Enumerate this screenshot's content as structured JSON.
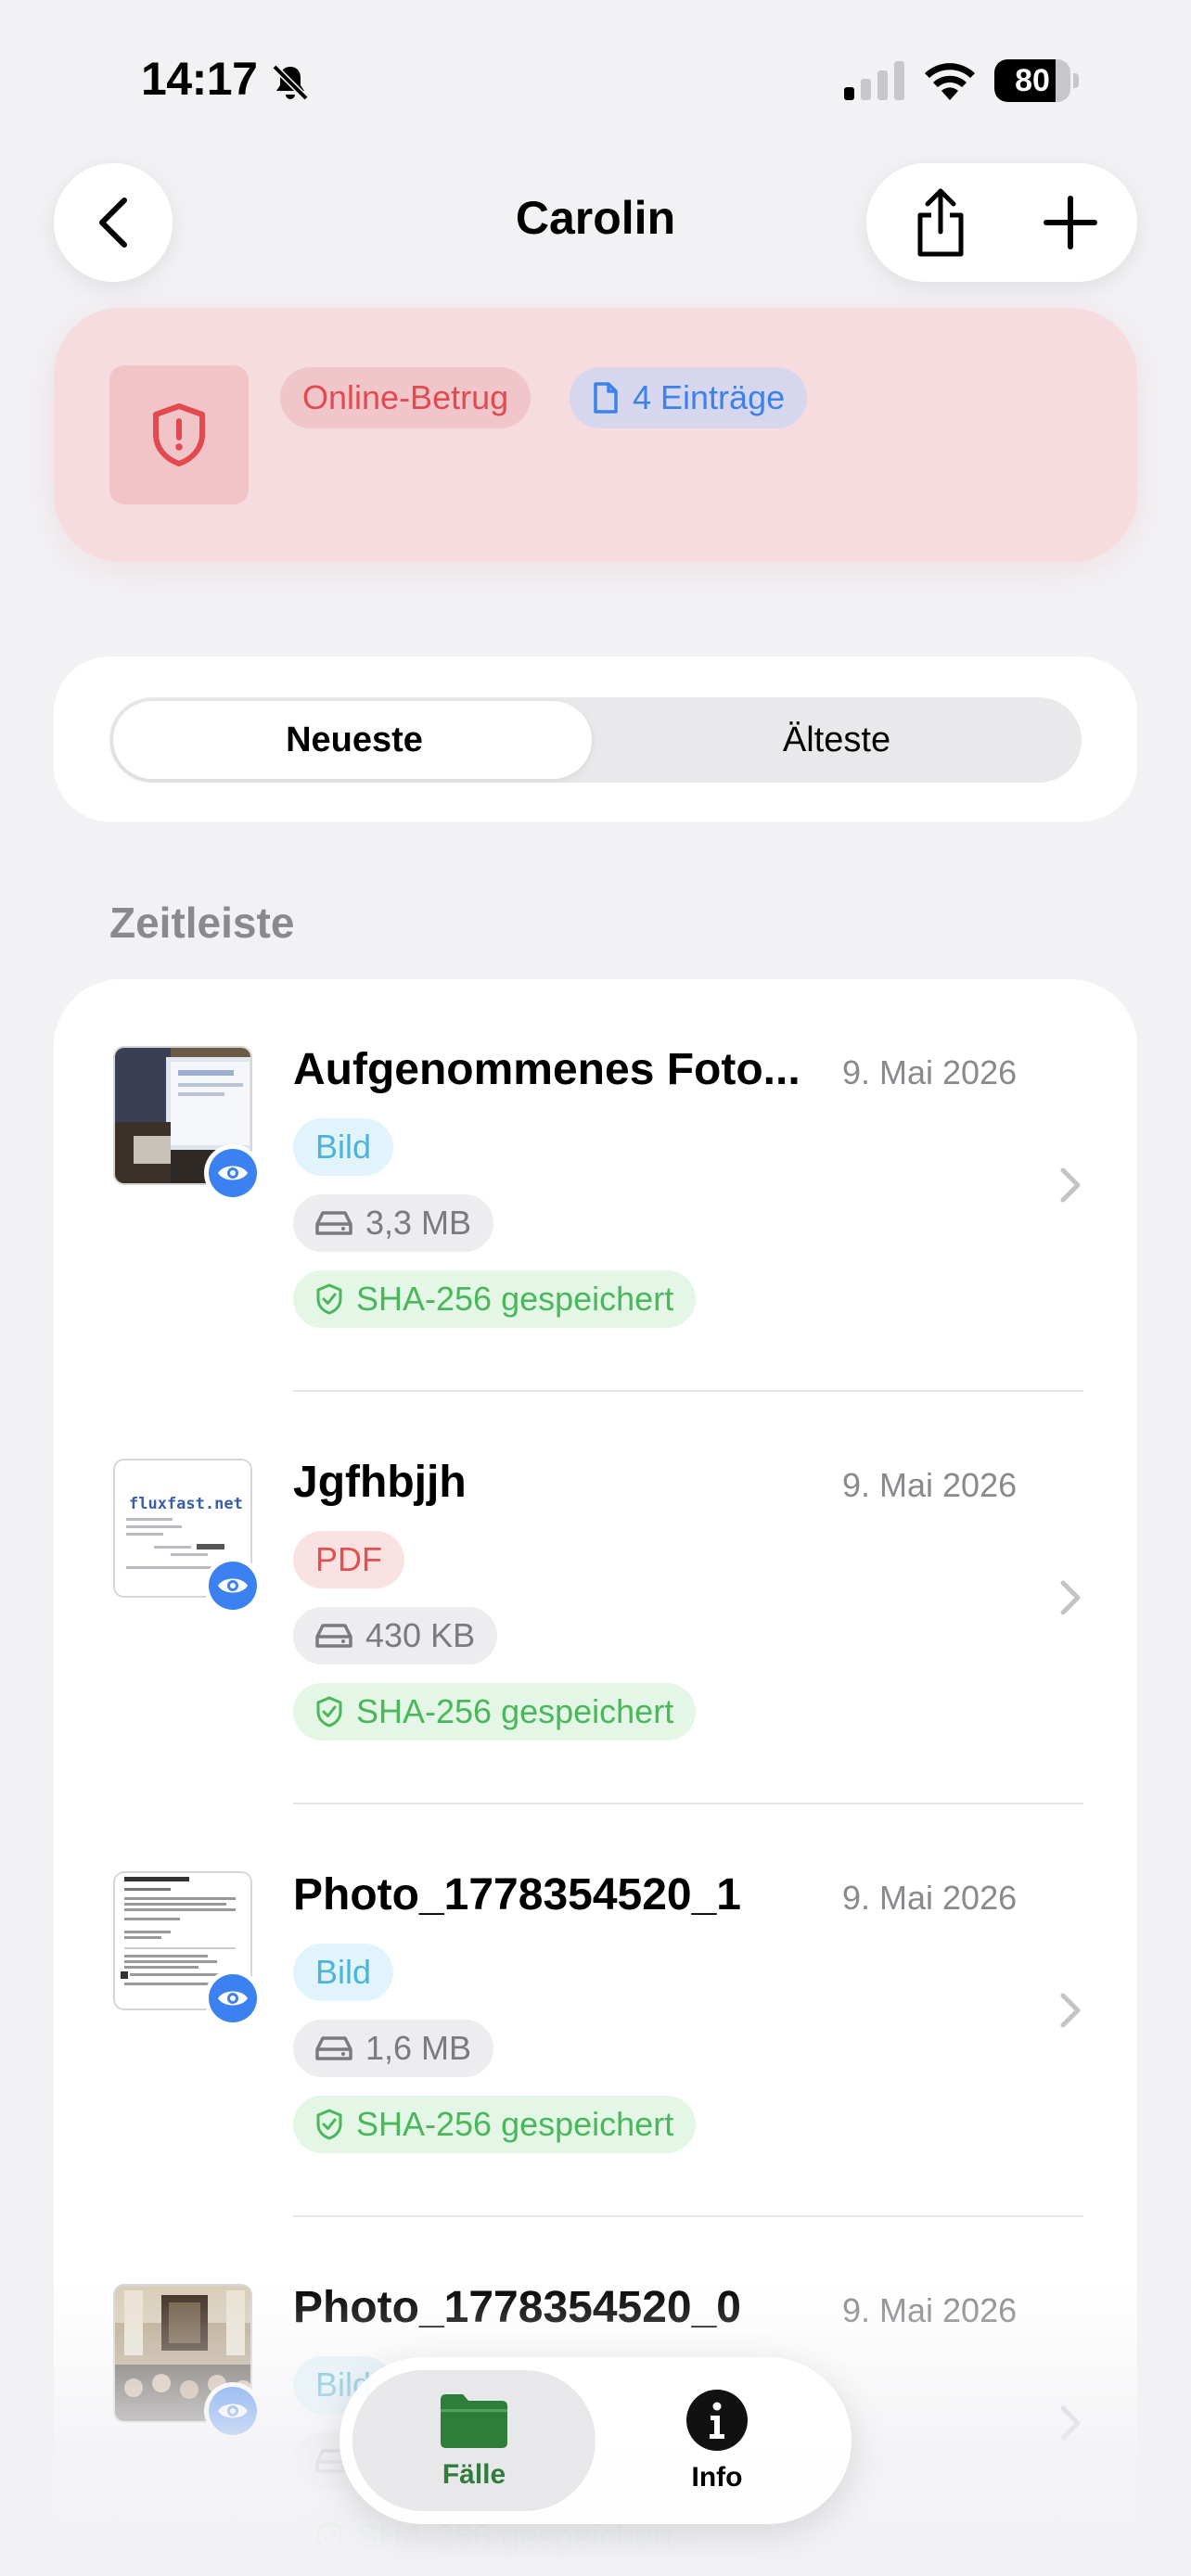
{
  "status": {
    "time": "14:17",
    "battery": "80",
    "battery_level": 0.8
  },
  "nav": {
    "title": "Carolin"
  },
  "case": {
    "category": "Online-Betrug",
    "entries": "4 Einträge",
    "accent": "#e24a4f"
  },
  "sort": {
    "options": [
      "Neueste",
      "Älteste"
    ],
    "selected": "Neueste"
  },
  "section_title": "Zeitleiste",
  "items": [
    {
      "title": "Aufgenommenes Foto...",
      "date": "9. Mai 2026",
      "type": "Bild",
      "size": "3,3 MB",
      "hash": "SHA-256 gespeichert"
    },
    {
      "title": "Jgfhbjjh",
      "date": "9. Mai 2026",
      "type": "PDF",
      "size": "430 KB",
      "hash": "SHA-256 gespeichert"
    },
    {
      "title": "Photo_1778354520_1",
      "date": "9. Mai 2026",
      "type": "Bild",
      "size": "1,6 MB",
      "hash": "SHA-256 gespeichert"
    },
    {
      "title": "Photo_1778354520_0",
      "date": "9. Mai 2026",
      "type": "Bild",
      "size": "",
      "hash": "SHA-256 gespeichert"
    }
  ],
  "tabs": [
    {
      "label": "Fälle",
      "icon": "folder-icon",
      "active": true
    },
    {
      "label": "Info",
      "icon": "info-icon",
      "active": false
    }
  ]
}
